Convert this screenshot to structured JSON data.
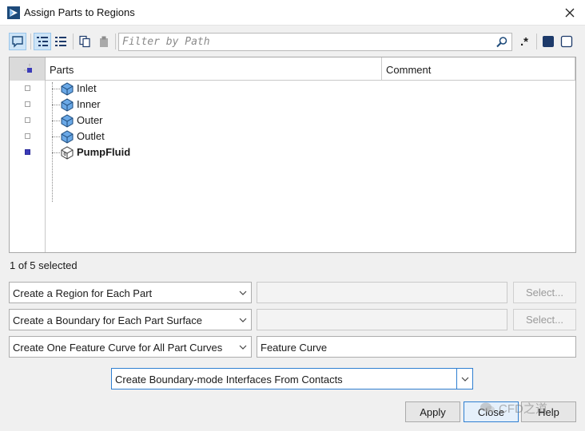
{
  "window": {
    "title": "Assign Parts to Regions",
    "close_glyph": "✕"
  },
  "toolbar": {
    "filter_placeholder": "Filter by Path",
    "regex_label": ".*",
    "buttons": [
      "speech-bubble-icon",
      "tree-view-icon",
      "list-view-icon",
      "copy-icon",
      "paste-icon",
      "filled-square-icon",
      "empty-square-icon"
    ]
  },
  "table": {
    "headers": {
      "parts": "Parts",
      "comment": "Comment"
    },
    "rows": [
      {
        "name": "Inlet",
        "selected": false,
        "bold": false,
        "icon": "part-surface-icon"
      },
      {
        "name": "Inner",
        "selected": false,
        "bold": false,
        "icon": "part-surface-icon"
      },
      {
        "name": "Outer",
        "selected": false,
        "bold": false,
        "icon": "part-surface-icon"
      },
      {
        "name": "Outlet",
        "selected": false,
        "bold": false,
        "icon": "part-surface-icon"
      },
      {
        "name": "PumpFluid",
        "selected": true,
        "bold": true,
        "icon": "part-body-icon"
      }
    ]
  },
  "status": "1 of 5 selected",
  "options": {
    "region_mode": "Create a Region for Each Part",
    "region_name": "",
    "boundary_mode": "Create a Boundary for Each Part Surface",
    "boundary_name": "",
    "feature_mode": "Create One Feature Curve for All Part Curves",
    "feature_name": "Feature Curve",
    "interface_mode": "Create Boundary-mode Interfaces From Contacts",
    "select_label": "Select..."
  },
  "buttons": {
    "apply": "Apply",
    "close": "Close",
    "help": "Help"
  },
  "watermark": "CFD之道",
  "colors": {
    "accent": "#2f7fd1",
    "selected_check": "#3b3bb8",
    "part_icon": "#3d7fcc"
  }
}
